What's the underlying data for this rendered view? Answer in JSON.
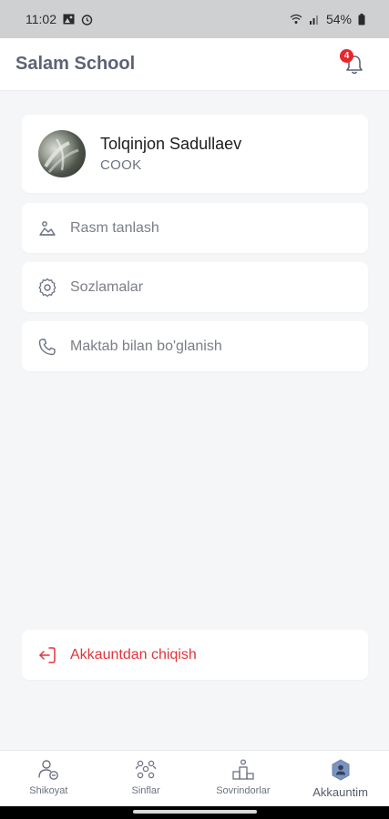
{
  "status_bar": {
    "time": "11:02",
    "battery": "54%",
    "icons": [
      "image-icon",
      "alarm-icon",
      "wifi-icon",
      "signal-icon",
      "battery-icon"
    ]
  },
  "app_bar": {
    "title": "Salam School",
    "notification_count": "4"
  },
  "profile": {
    "name": "Tolqinjon Sadullaev",
    "role": "COOK"
  },
  "menu": {
    "items": [
      {
        "label": "Rasm tanlash",
        "icon": "image-picker-icon"
      },
      {
        "label": "Sozlamalar",
        "icon": "gear-icon"
      },
      {
        "label": "Maktab bilan bo'glanish",
        "icon": "phone-icon"
      }
    ],
    "logout_label": "Akkauntdan chiqish"
  },
  "bottom_nav": {
    "items": [
      {
        "label": "Shikoyat",
        "icon": "user-complaint-icon"
      },
      {
        "label": "Sinflar",
        "icon": "classes-icon"
      },
      {
        "label": "Sovrindorlar",
        "icon": "podium-icon"
      },
      {
        "label": "Akkauntim",
        "icon": "account-icon",
        "active": true
      }
    ]
  },
  "colors": {
    "accent_text": "#5b6474",
    "danger": "#e0353b",
    "badge": "#e8262b",
    "background": "#f5f6f8"
  }
}
